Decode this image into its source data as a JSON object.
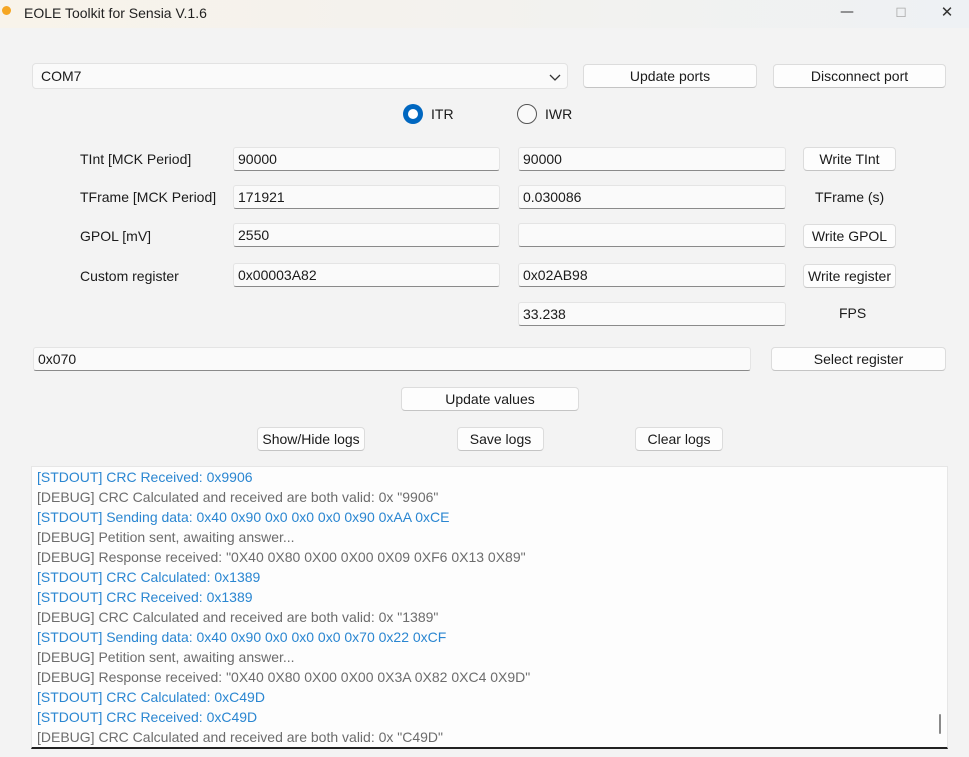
{
  "window": {
    "title": "EOLE Toolkit for Sensia V.1.6"
  },
  "port": {
    "selected": "COM7",
    "update_label": "Update ports",
    "disconnect_label": "Disconnect port"
  },
  "mode": {
    "options": [
      {
        "label": "ITR",
        "selected": true
      },
      {
        "label": "IWR",
        "selected": false
      }
    ]
  },
  "params": {
    "tint": {
      "label": "TInt [MCK Period]",
      "value": "90000",
      "value2": "90000",
      "button": "Write TInt"
    },
    "tframe": {
      "label": "TFrame [MCK Period]",
      "value": "171921",
      "value2": "0.030086",
      "unit": "TFrame (s)"
    },
    "gpol": {
      "label": "GPOL [mV]",
      "value": "2550",
      "value2": "",
      "button": "Write GPOL"
    },
    "custom": {
      "label": "Custom register",
      "value": "0x00003A82",
      "value2": "0x02AB98",
      "button": "Write register"
    },
    "fps": {
      "value": "33.238",
      "unit": "FPS"
    }
  },
  "register": {
    "value": "0x070",
    "select_label": "Select register"
  },
  "actions": {
    "update_values": "Update values",
    "show_hide_logs": "Show/Hide logs",
    "save_logs": "Save logs",
    "clear_logs": "Clear logs"
  },
  "logs": [
    {
      "type": "stdout",
      "text": "[STDOUT] CRC Received: 0x9906"
    },
    {
      "type": "debug",
      "text": "[DEBUG] CRC Calculated and received are both valid: 0x \"9906\""
    },
    {
      "type": "stdout",
      "text": "[STDOUT] Sending data: 0x40 0x90 0x0 0x0 0x0 0x90 0xAA 0xCE"
    },
    {
      "type": "debug",
      "text": "[DEBUG] Petition sent, awaiting answer..."
    },
    {
      "type": "debug",
      "text": "[DEBUG] Response received: \"0X40 0X80 0X00 0X00 0X09 0XF6 0X13 0X89\""
    },
    {
      "type": "stdout",
      "text": "[STDOUT] CRC Calculated: 0x1389"
    },
    {
      "type": "stdout",
      "text": "[STDOUT] CRC Received: 0x1389"
    },
    {
      "type": "debug",
      "text": "[DEBUG] CRC Calculated and received are both valid: 0x \"1389\""
    },
    {
      "type": "stdout",
      "text": "[STDOUT] Sending data: 0x40 0x90 0x0 0x0 0x0 0x70 0x22 0xCF"
    },
    {
      "type": "debug",
      "text": "[DEBUG] Petition sent, awaiting answer..."
    },
    {
      "type": "debug",
      "text": "[DEBUG] Response received: \"0X40 0X80 0X00 0X00 0X3A 0X82 0XC4 0X9D\""
    },
    {
      "type": "stdout",
      "text": "[STDOUT] CRC Calculated: 0xC49D"
    },
    {
      "type": "stdout",
      "text": "[STDOUT] CRC Received: 0xC49D"
    },
    {
      "type": "debug",
      "text": "[DEBUG] CRC Calculated and received are both valid: 0x \"C49D\""
    }
  ]
}
